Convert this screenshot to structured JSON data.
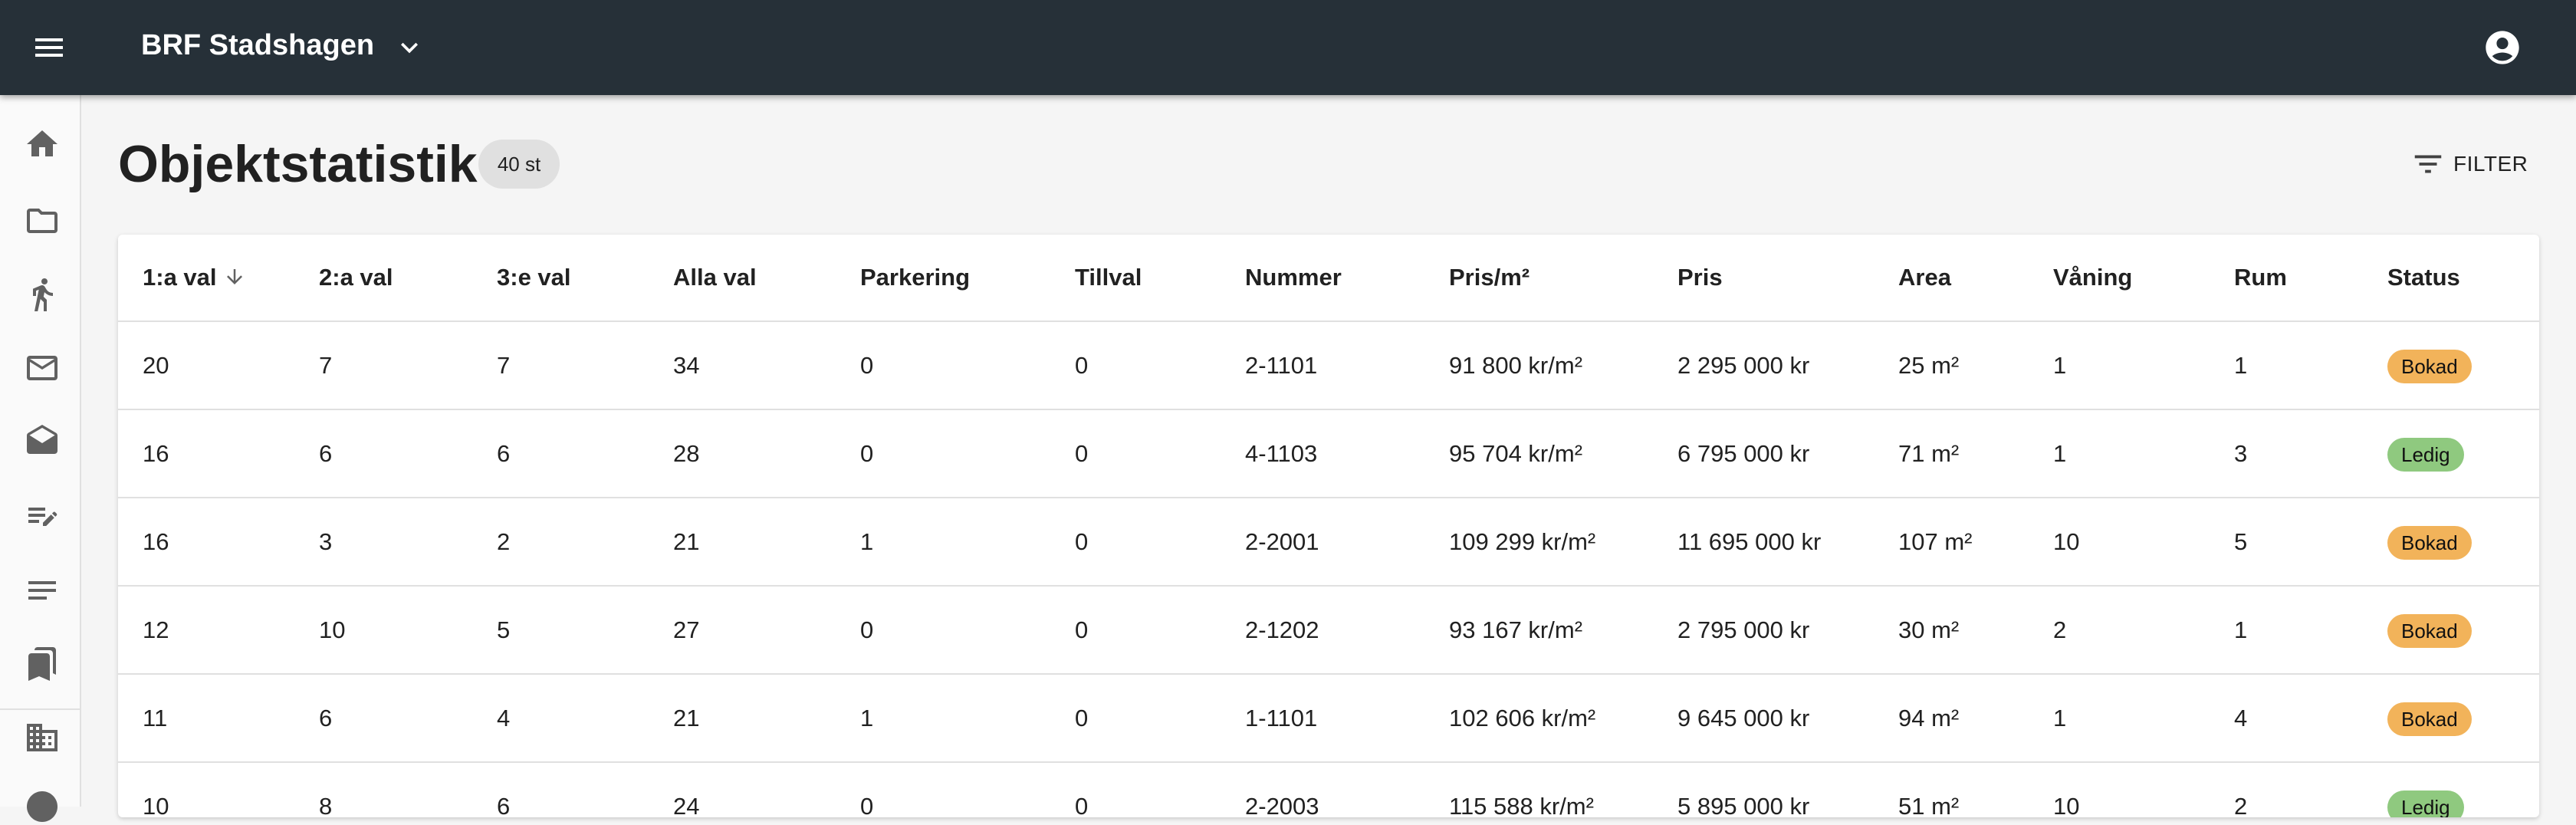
{
  "appbar": {
    "title": "BRF Stadshagen"
  },
  "page": {
    "title": "Objektstatistik",
    "count": "40 st"
  },
  "toolbar": {
    "filter_label": "FILTER"
  },
  "sidebar": {
    "items": [
      {
        "icon": "home-icon"
      },
      {
        "icon": "folder-icon"
      },
      {
        "icon": "person-walking-icon"
      },
      {
        "icon": "mail-icon"
      },
      {
        "icon": "drafts-icon"
      },
      {
        "icon": "edit-note-icon"
      },
      {
        "icon": "notes-icon"
      },
      {
        "icon": "bookmarks-icon"
      },
      {
        "icon": "apartment-icon"
      },
      {
        "icon": "info-icon"
      }
    ]
  },
  "table": {
    "columns": [
      "1:a val",
      "2:a val",
      "3:e val",
      "Alla val",
      "Parkering",
      "Tillval",
      "Nummer",
      "Pris/m²",
      "Pris",
      "Area",
      "Våning",
      "Rum",
      "Status"
    ],
    "sort_column": "1:a val",
    "rows": [
      [
        "20",
        "7",
        "7",
        "34",
        "0",
        "0",
        "2-1101",
        "91 800 kr/m²",
        "2 295 000 kr",
        "25 m²",
        "1",
        "1",
        "Bokad"
      ],
      [
        "16",
        "6",
        "6",
        "28",
        "0",
        "0",
        "4-1103",
        "95 704 kr/m²",
        "6 795 000 kr",
        "71 m²",
        "1",
        "3",
        "Ledig"
      ],
      [
        "16",
        "3",
        "2",
        "21",
        "1",
        "0",
        "2-2001",
        "109 299 kr/m²",
        "11 695 000 kr",
        "107 m²",
        "10",
        "5",
        "Bokad"
      ],
      [
        "12",
        "10",
        "5",
        "27",
        "0",
        "0",
        "2-1202",
        "93 167 kr/m²",
        "2 795 000 kr",
        "30 m²",
        "2",
        "1",
        "Bokad"
      ],
      [
        "11",
        "6",
        "4",
        "21",
        "1",
        "0",
        "1-1101",
        "102 606 kr/m²",
        "9 645 000 kr",
        "94 m²",
        "1",
        "4",
        "Bokad"
      ],
      [
        "10",
        "8",
        "6",
        "24",
        "0",
        "0",
        "2-2003",
        "115 588 kr/m²",
        "5 895 000 kr",
        "51 m²",
        "10",
        "2",
        "Ledig"
      ]
    ]
  },
  "colors": {
    "appbar": "#263038",
    "status_bokad": "#f2b35a",
    "status_ledig": "#8fc97f"
  }
}
